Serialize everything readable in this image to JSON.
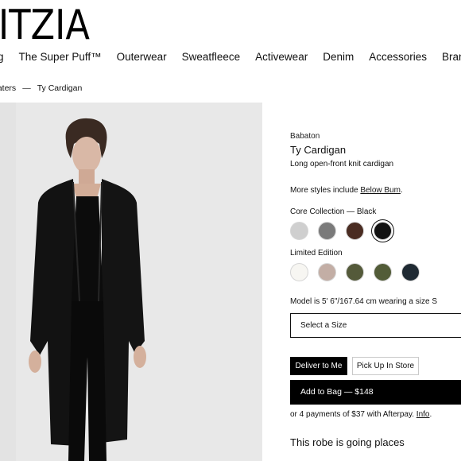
{
  "header": {
    "logo": "ITZIA",
    "nav": [
      "hing",
      "The Super Puff™",
      "Outerwear",
      "Sweatfleece",
      "Activewear",
      "Denim",
      "Accessories",
      "Bran"
    ]
  },
  "breadcrumb": {
    "parent": "eaters",
    "separator": "—",
    "current": "Ty Cardigan"
  },
  "product": {
    "brand": "Babaton",
    "name": "Ty Cardigan",
    "description": "Long open-front knit cardigan",
    "more_styles_prefix": "More styles include ",
    "more_styles_link": "Below Bum",
    "more_styles_suffix": ".",
    "core_collection_label": "Core Collection — Black",
    "core_colors": [
      "#cfcfcf",
      "#7a7a7a",
      "#4a2c22",
      "#111111"
    ],
    "core_selected_index": 3,
    "limited_label": "Limited Edition",
    "limited_colors": [
      "#f7f6f2",
      "#c3aea5",
      "#545a3a",
      "#525c38",
      "#1f2a33"
    ],
    "model_info": "Model is 5' 6\"/167.64 cm wearing a size S",
    "size_placeholder": "Select a Size",
    "deliver_label": "Deliver to Me",
    "pickup_label": "Pick Up In Store",
    "add_to_bag_label": "Add to Bag — $148",
    "afterpay_text": "or 4 payments of $37 with Afterpay. ",
    "afterpay_link": "Info",
    "afterpay_suffix": ".",
    "tagline": "This robe is going places"
  }
}
